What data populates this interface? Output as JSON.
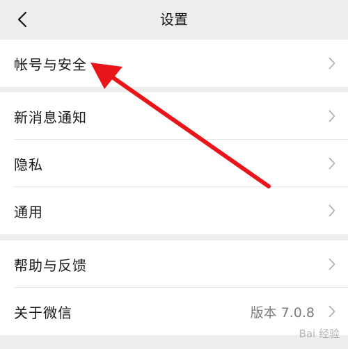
{
  "nav": {
    "title": "设置",
    "back_icon": "chevron-left-icon"
  },
  "groups": [
    {
      "items": [
        {
          "label": "帐号与安全"
        }
      ]
    },
    {
      "items": [
        {
          "label": "新消息通知"
        },
        {
          "label": "隐私"
        },
        {
          "label": "通用"
        }
      ]
    },
    {
      "items": [
        {
          "label": "帮助与反馈"
        },
        {
          "label": "关于微信",
          "value": "版本 7.0.8"
        }
      ]
    }
  ],
  "annotation": {
    "arrow_color": "#e8151b",
    "watermark_text": "Bai 经验"
  },
  "colors": {
    "background": "#ededed",
    "card": "#ffffff",
    "divider": "#e5e5e5"
  }
}
